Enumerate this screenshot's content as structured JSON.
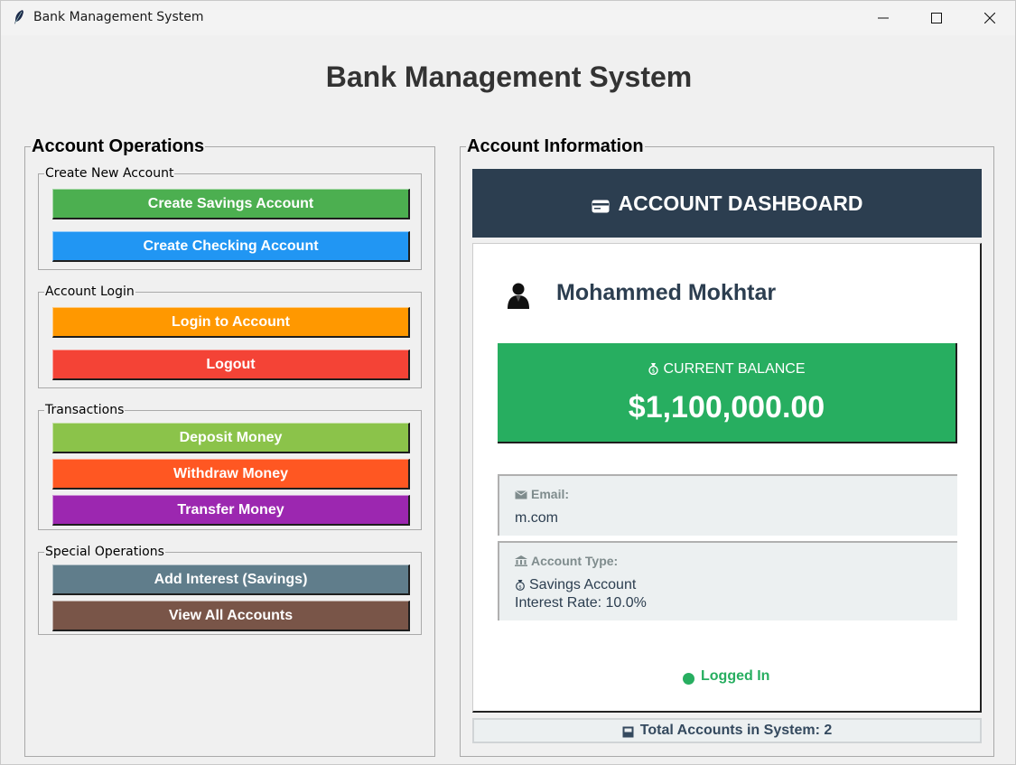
{
  "window": {
    "title": "Bank Management System"
  },
  "header": {
    "title": "Bank Management System"
  },
  "left": {
    "frame_label": "Account Operations",
    "groups": [
      {
        "label": "Create New Account",
        "buttons": [
          {
            "label": "Create Savings Account",
            "color": "#4caf50"
          },
          {
            "label": "Create Checking Account",
            "color": "#2196f3"
          }
        ]
      },
      {
        "label": "Account Login",
        "buttons": [
          {
            "label": "Login to Account",
            "color": "#ff9800"
          },
          {
            "label": "Logout",
            "color": "#f44336"
          }
        ]
      },
      {
        "label": "Transactions",
        "buttons": [
          {
            "label": "Deposit Money",
            "color": "#8bc34a"
          },
          {
            "label": "Withdraw Money",
            "color": "#ff5722"
          },
          {
            "label": "Transfer Money",
            "color": "#9c27b0"
          }
        ]
      },
      {
        "label": "Special Operations",
        "buttons": [
          {
            "label": "Add Interest (Savings)",
            "color": "#607d8b"
          },
          {
            "label": "View All Accounts",
            "color": "#795548"
          }
        ]
      }
    ]
  },
  "right": {
    "frame_label": "Account Information",
    "dashboard_title": "ACCOUNT DASHBOARD",
    "user_name": "Mohammed Mokhtar",
    "balance_label": "CURRENT BALANCE",
    "balance_value": "$1,100,000.00",
    "email_label": "Email:",
    "email_value": "m.com",
    "account_type_label": "Account Type:",
    "account_type_value": "Savings Account",
    "interest_rate": "Interest Rate: 10.0%",
    "status": "Logged In",
    "total_accounts": "Total Accounts in System: 2",
    "colors": {
      "header_bg": "#2c3e50",
      "balance_bg": "#27ae60",
      "status": "#27ae60"
    }
  }
}
